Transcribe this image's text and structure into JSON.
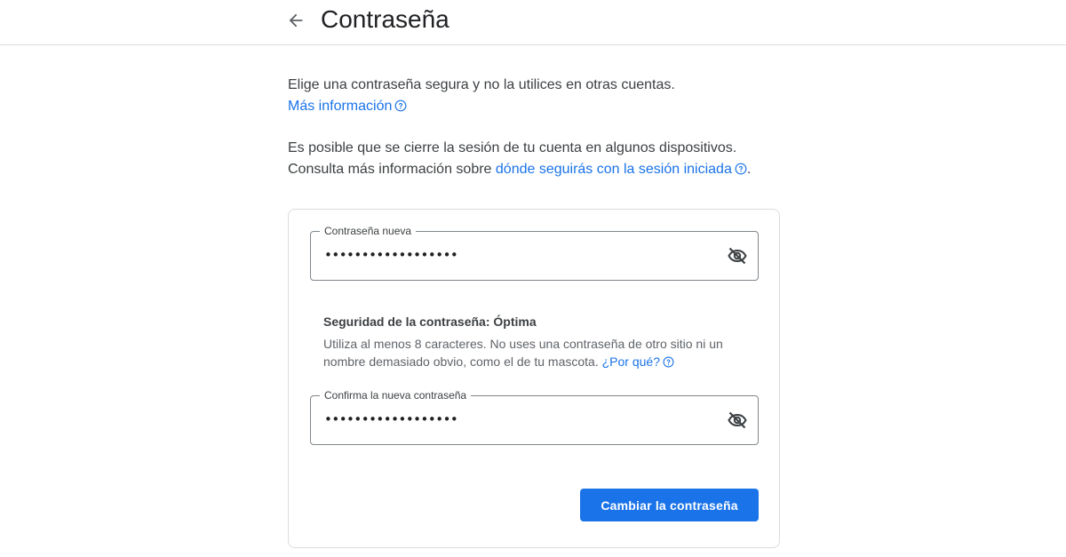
{
  "header": {
    "back_icon": "arrow-left-icon",
    "title": "Contraseña"
  },
  "intro": {
    "text": "Elige una contraseña segura y no la utilices en otras cuentas.",
    "more_info_link": "Más información"
  },
  "session_notice": {
    "line1": "Es posible que se cierre la sesión de tu cuenta en algunos dispositivos.",
    "line2_prefix": "Consulta más información sobre ",
    "line2_link": "dónde seguirás con la sesión iniciada",
    "line2_suffix": "."
  },
  "form": {
    "new_password": {
      "label": "Contraseña nueva",
      "value": "••••••••••••••••••",
      "toggle_icon": "eye-off-icon"
    },
    "strength": {
      "title": "Seguridad de la contraseña: Óptima",
      "description": "Utiliza al menos 8 caracteres. No uses una contraseña de otro sitio ni un nombre demasiado obvio, como el de tu mascota. ",
      "why_link": "¿Por qué?"
    },
    "confirm_password": {
      "label": "Confirma la nueva contraseña",
      "value": "••••••••••••••••••",
      "toggle_icon": "eye-off-icon"
    },
    "submit_label": "Cambiar la contraseña"
  },
  "colors": {
    "accent": "#1a73e8",
    "text": "#202124",
    "secondary_text": "#5f6368",
    "border": "#dadce0"
  }
}
